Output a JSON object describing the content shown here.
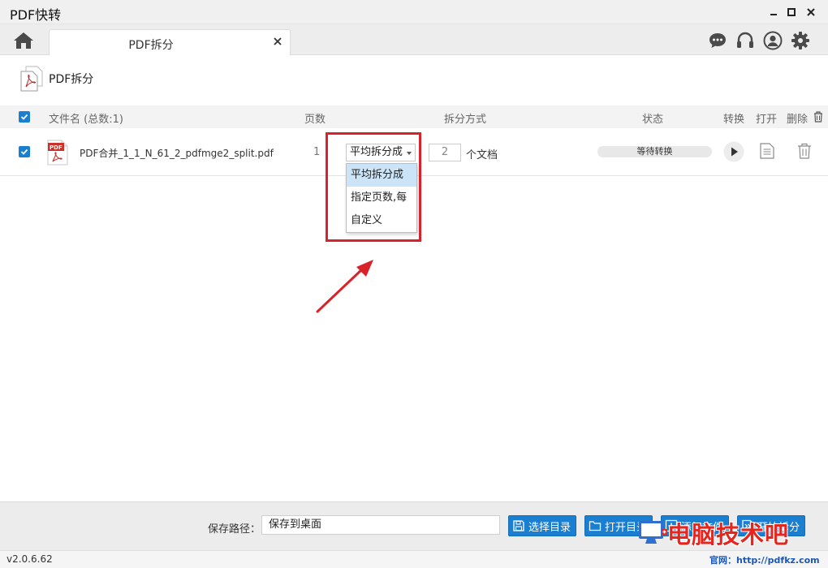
{
  "window": {
    "title": "PDF快转",
    "controls": [
      "minimize-icon",
      "maximize-icon",
      "close-icon"
    ]
  },
  "tabs": [
    {
      "label": "PDF拆分",
      "active": true
    }
  ],
  "toolbar_icons": [
    "chat-icon",
    "headset-icon",
    "user-icon",
    "gear-icon"
  ],
  "page": {
    "heading": "PDF拆分"
  },
  "table": {
    "headers": {
      "filename": "文件名 (总数:1)",
      "pages": "页数",
      "split_mode": "拆分方式",
      "status": "状态",
      "convert": "转换",
      "open": "打开",
      "delete": "删除"
    },
    "rows": [
      {
        "checked": true,
        "filename": "PDF合并_1_1_N_61_2_pdfmge2_split.pdf",
        "pages": "1",
        "split_mode": "平均拆分成",
        "count": "2",
        "unit": "个文档",
        "status": "等待转换"
      }
    ]
  },
  "dropdown": {
    "options": [
      "平均拆分成",
      "指定页数,每",
      "自定义"
    ],
    "selected": "平均拆分成"
  },
  "bottom": {
    "save_label": "保存路径：",
    "save_value": "保存到桌面",
    "buttons": {
      "choose_dir": "选择目录",
      "open_dir": "打开目录",
      "add_file": "添加文件",
      "start": "开始拆分"
    }
  },
  "statusbar": {
    "version": "v2.0.6.62"
  },
  "watermark": {
    "text": "电脑技术吧",
    "url": "官网：http://pdfkz.com"
  },
  "colors": {
    "accent": "#1a7fd1",
    "highlight": "#d9232a",
    "selected": "#cce4f7"
  }
}
